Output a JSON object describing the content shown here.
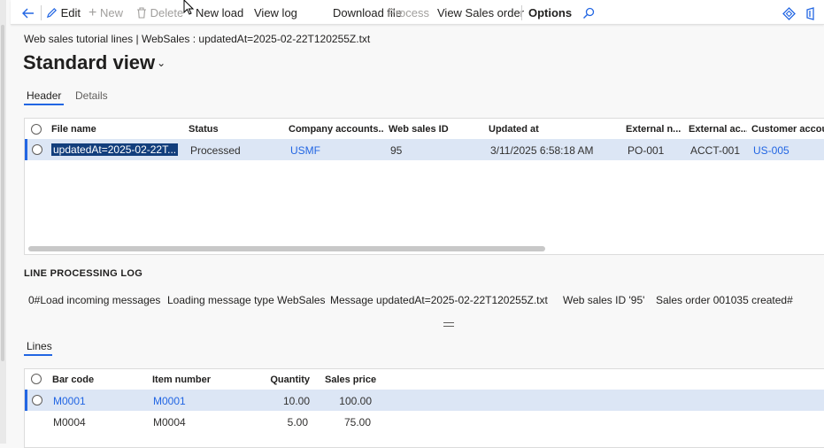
{
  "action_pane": {
    "edit": "Edit",
    "new": "New",
    "delete": "Delete",
    "new_load": "New load",
    "view_log": "View log",
    "download_file": "Download file",
    "process": "Process",
    "view_sales_order": "View Sales order",
    "options": "Options"
  },
  "breadcrumb": "Web sales tutorial lines  |  WebSales : updatedAt=2025-02-22T120255Z.txt",
  "view_title": "Standard view",
  "header_tabs": [
    "Header",
    "Details"
  ],
  "header_grid": {
    "columns": [
      "File name",
      "Status",
      "Company accounts...",
      "Web sales ID",
      "Updated at",
      "External n...",
      "External ac...",
      "Customer account"
    ],
    "rows": [
      {
        "file_name": "updatedAt=2025-02-22T...",
        "status": "Processed",
        "company": "USMF",
        "web_sales_id": "95",
        "updated_at": "3/11/2025 6:58:18 AM",
        "external_n": "PO-001",
        "external_ac": "ACCT-001",
        "customer_account": "US-005"
      }
    ]
  },
  "log": {
    "label": "LINE PROCESSING LOG",
    "parts": [
      "0#Load incoming messages",
      "Loading message type WebSales",
      "Message updatedAt=2025-02-22T120255Z.txt",
      "Web sales ID '95'",
      "Sales order 001035 created#"
    ]
  },
  "lines_tab": "Lines",
  "lines_grid": {
    "columns": [
      "Bar code",
      "Item number",
      "Quantity",
      "Sales price"
    ],
    "rows": [
      {
        "bar_code": "M0001",
        "item_number": "M0001",
        "quantity": "10.00",
        "sales_price": "100.00"
      },
      {
        "bar_code": "M0004",
        "item_number": "M0004",
        "quantity": "5.00",
        "sales_price": "75.00"
      }
    ]
  },
  "colors": {
    "accent": "#2266e3",
    "selected_row": "#dce6f5",
    "selected_text_bg": "#123e7c"
  }
}
